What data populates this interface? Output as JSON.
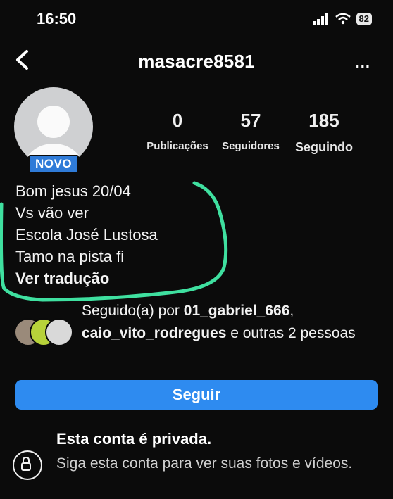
{
  "status_bar": {
    "time": "16:50",
    "battery": "82"
  },
  "header": {
    "username": "masacre8581",
    "more_label": "..."
  },
  "profile": {
    "new_badge": "NOVO",
    "stats": [
      {
        "value": "0",
        "label": "Publicações"
      },
      {
        "value": "57",
        "label": "Seguidores"
      },
      {
        "value": "185",
        "label": "Seguindo"
      }
    ],
    "bio_lines": [
      "Bom jesus 20/04",
      "Vs vão ver",
      "Escola José Lustosa",
      "Tamo na pista fi"
    ],
    "translate_label": "Ver tradução"
  },
  "followed_by": {
    "prefix": "Seguido(a) por ",
    "user1": "01_gabriel_666",
    "sep": ",",
    "user2": "caio_vito_rodregues",
    "suffix": " e outras 2 pessoas"
  },
  "follow_button": {
    "label": "Seguir"
  },
  "private": {
    "title": "Esta conta é privada.",
    "description": "Siga esta conta para ver suas fotos e vídeos."
  },
  "colors": {
    "accent": "#2e8bf0",
    "badge": "#2f7bd8",
    "highlight": "#3fe0a0"
  }
}
